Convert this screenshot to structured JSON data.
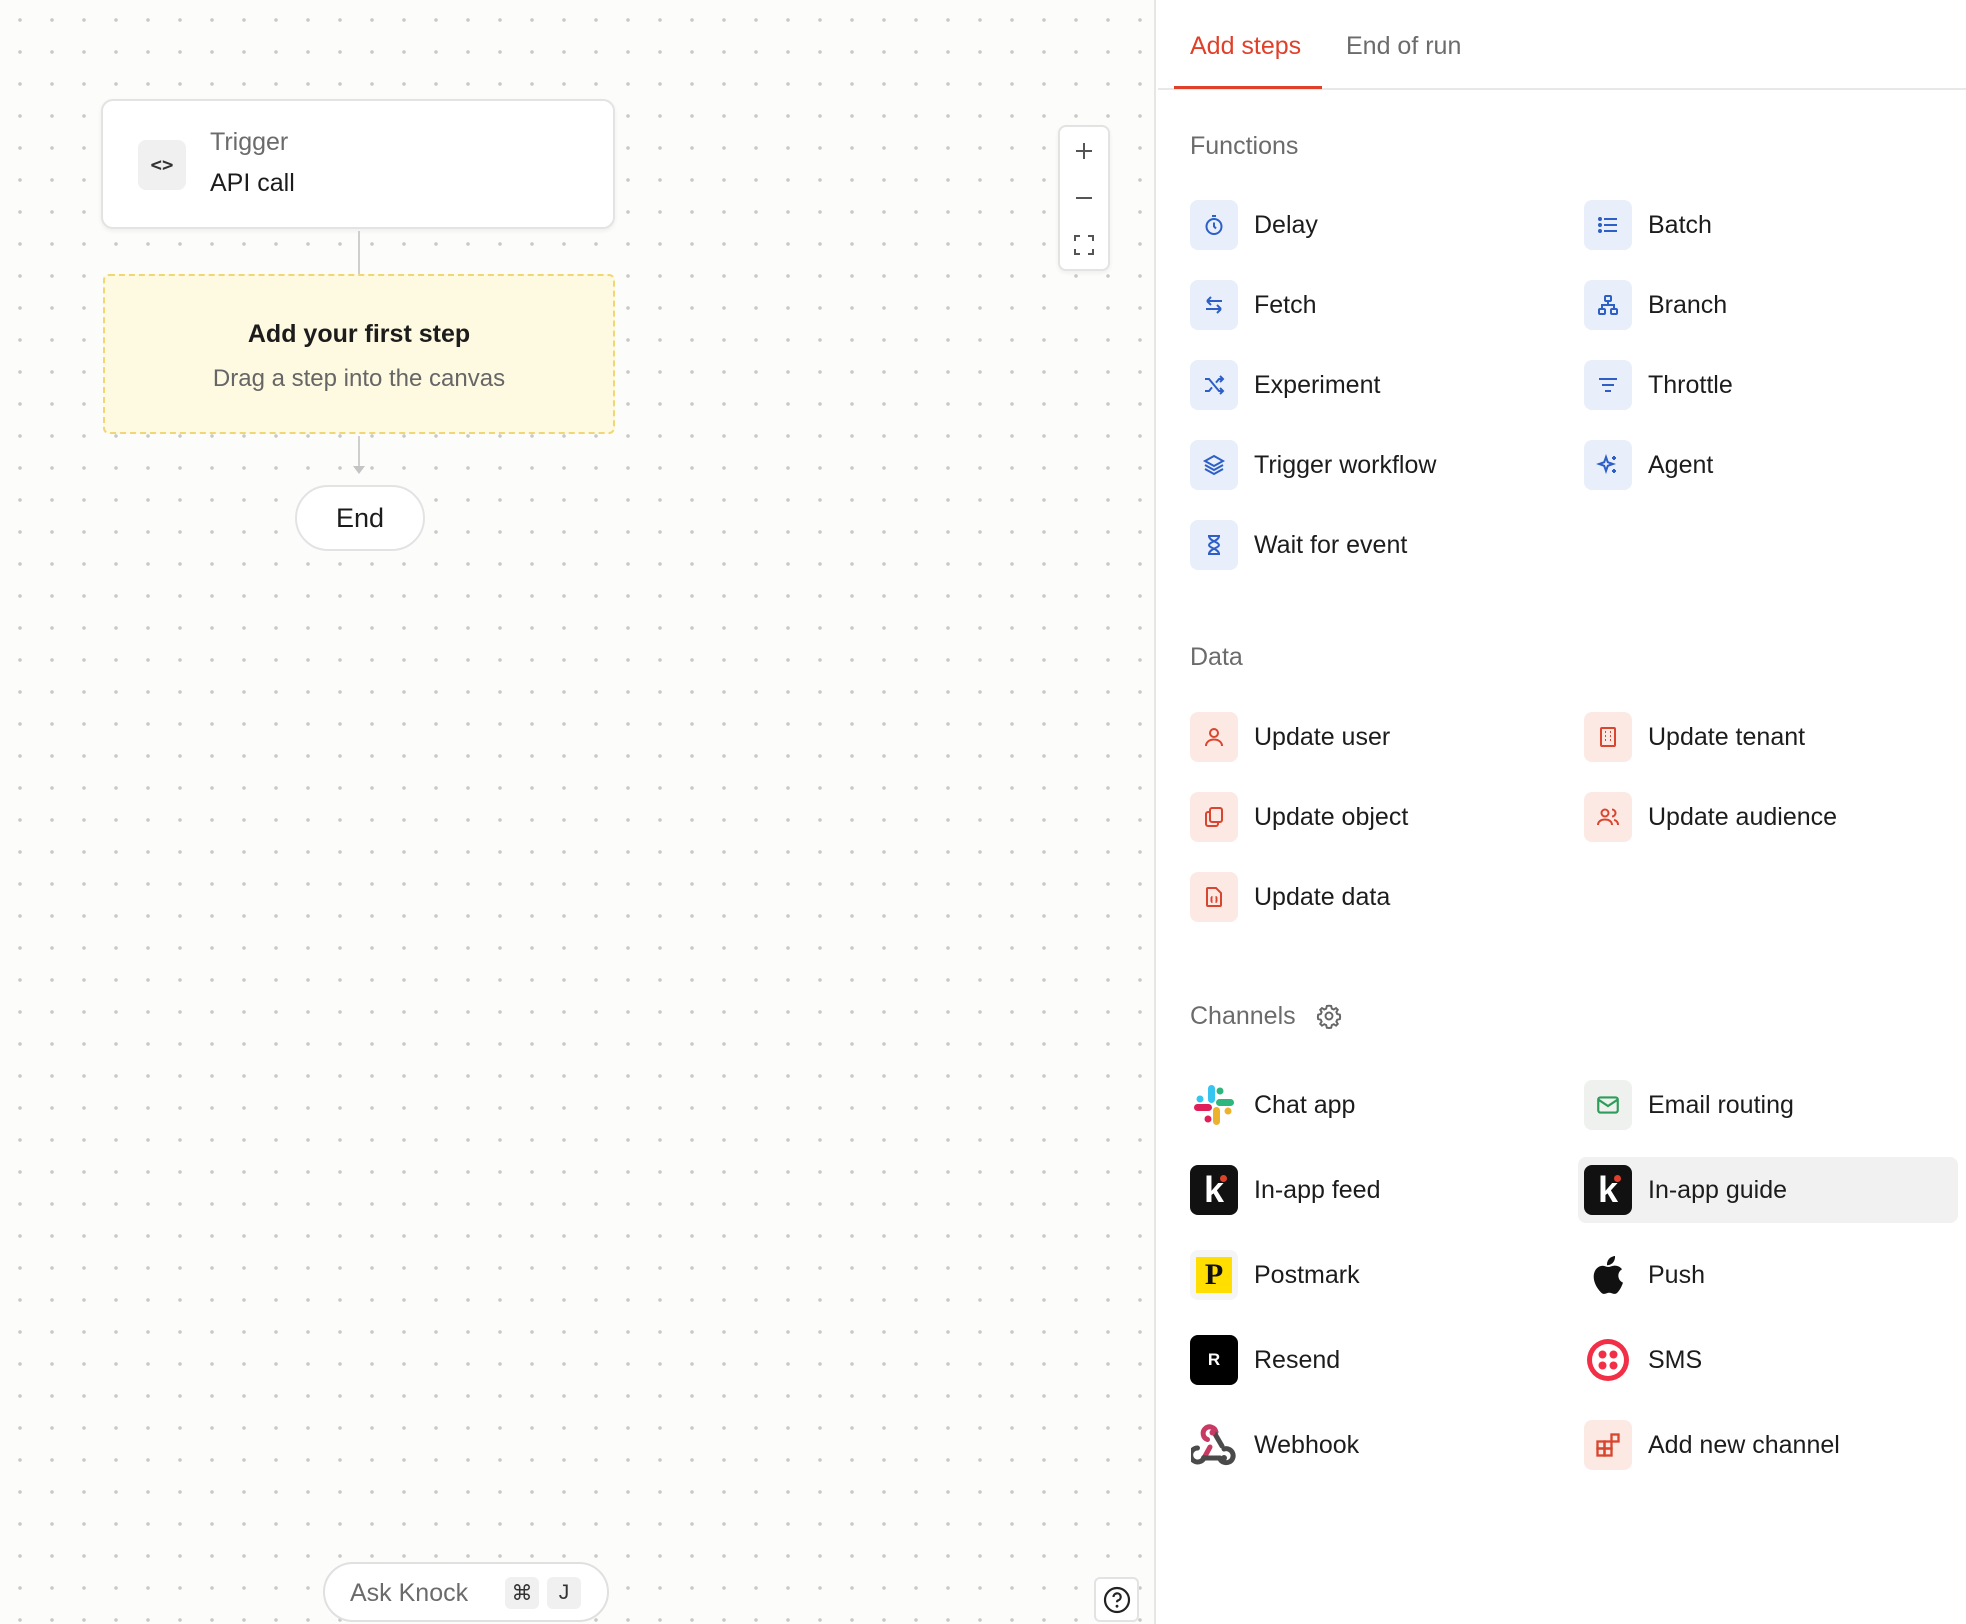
{
  "canvas": {
    "trigger": {
      "label": "Trigger",
      "value": "API call",
      "icon": "code-icon"
    },
    "placeholder": {
      "title": "Add your first step",
      "subtitle": "Drag a step into the canvas"
    },
    "end": "End",
    "zoom": {
      "in": "+",
      "out": "—"
    },
    "ask": {
      "label": "Ask Knock",
      "key1": "⌘",
      "key2": "J"
    },
    "help": "?"
  },
  "tabs": {
    "add": "Add steps",
    "end": "End of run",
    "active": "Add steps"
  },
  "sections": {
    "functions": "Functions",
    "data": "Data",
    "channels": "Channels"
  },
  "functions": [
    {
      "label": "Delay",
      "icon": "stopwatch-icon"
    },
    {
      "label": "Batch",
      "icon": "list-icon"
    },
    {
      "label": "Fetch",
      "icon": "arrows-exchange-icon"
    },
    {
      "label": "Branch",
      "icon": "hierarchy-icon"
    },
    {
      "label": "Experiment",
      "icon": "shuffle-icon"
    },
    {
      "label": "Throttle",
      "icon": "filter-icon"
    },
    {
      "label": "Trigger workflow",
      "icon": "layers-icon"
    },
    {
      "label": "Agent",
      "icon": "sparkle-icon"
    },
    {
      "label": "Wait for event",
      "icon": "hourglass-icon"
    }
  ],
  "data_items": [
    {
      "label": "Update user",
      "icon": "user-icon"
    },
    {
      "label": "Update tenant",
      "icon": "building-icon"
    },
    {
      "label": "Update object",
      "icon": "copy-icon"
    },
    {
      "label": "Update audience",
      "icon": "users-icon"
    },
    {
      "label": "Update data",
      "icon": "file-braces-icon"
    }
  ],
  "channels": [
    {
      "label": "Chat app",
      "icon": "slack-icon"
    },
    {
      "label": "Email routing",
      "icon": "mail-icon"
    },
    {
      "label": "In-app feed",
      "icon": "knock-icon"
    },
    {
      "label": "In-app guide",
      "icon": "knock-icon",
      "selected": true
    },
    {
      "label": "Postmark",
      "icon": "postmark-icon",
      "logo_text": "P"
    },
    {
      "label": "Push",
      "icon": "apple-icon"
    },
    {
      "label": "Resend",
      "icon": "resend-icon",
      "logo_text": "R"
    },
    {
      "label": "SMS",
      "icon": "twilio-icon"
    },
    {
      "label": "Webhook",
      "icon": "webhook-icon"
    },
    {
      "label": "Add new channel",
      "icon": "add-blocks-icon"
    }
  ],
  "colors": {
    "accent": "#e0402a",
    "function_icon": "#2d5fc7",
    "data_icon": "#d9452f"
  }
}
